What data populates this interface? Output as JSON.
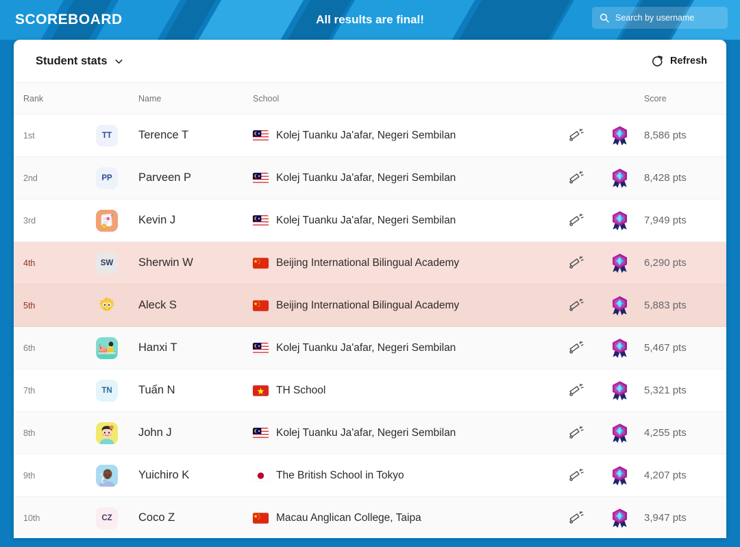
{
  "header": {
    "brand": "SCOREBOARD",
    "banner": "All results are final!",
    "search_placeholder": "Search by username",
    "search_value": "",
    "search_icon": "search-icon",
    "accent_blue": "#1b96d8",
    "header_blue": "#0c7cbe"
  },
  "toolbar": {
    "stats_label": "Student stats",
    "stats_caret_icon": "chevron-down-icon",
    "refresh_label": "Refresh",
    "refresh_icon": "refresh-icon"
  },
  "table": {
    "columns": [
      "Rank",
      "Name",
      "School",
      "Score"
    ],
    "megaphone_icon": "megaphone-icon",
    "badge_icon": "gem-award-badge-icon",
    "highlight_color": "#f9dfda",
    "rows": [
      {
        "rank": "1st",
        "name": "Terence T",
        "school": "Kolej Tuanku Ja'afar, Negeri Sembilan",
        "flag": "flag-malaysia",
        "score": "8,586 pts",
        "avatar_type": "initials",
        "avatar_text": "TT",
        "avatar_bg": "#eef2fb",
        "avatar_fg": "#2b4a8e",
        "highlight": false
      },
      {
        "rank": "2nd",
        "name": "Parveen P",
        "school": "Kolej Tuanku Ja'afar, Negeri Sembilan",
        "flag": "flag-malaysia",
        "score": "8,428 pts",
        "avatar_type": "initials",
        "avatar_text": "PP",
        "avatar_bg": "#eef2fb",
        "avatar_fg": "#2b4a8e",
        "highlight": false
      },
      {
        "rank": "3rd",
        "name": "Kevin J",
        "school": "Kolej Tuanku Ja'afar, Negeri Sembilan",
        "flag": "flag-malaysia",
        "score": "7,949 pts",
        "avatar_type": "picture-certificate",
        "avatar_text": "",
        "avatar_bg": "#f2a173",
        "avatar_fg": "#ffffff",
        "highlight": false
      },
      {
        "rank": "4th",
        "name": "Sherwin W",
        "school": "Beijing International Bilingual Academy",
        "flag": "flag-china",
        "score": "6,290 pts",
        "avatar_type": "initials",
        "avatar_text": "SW",
        "avatar_bg": "#e8e8e8",
        "avatar_fg": "#2b3a5e",
        "highlight": true
      },
      {
        "rank": "5th",
        "name": "Aleck S",
        "school": "Beijing International Bilingual Academy",
        "flag": "flag-china",
        "score": "5,883 pts",
        "avatar_type": "picture-monster",
        "avatar_text": "",
        "avatar_bg": "#f5d9d3",
        "avatar_fg": "#f6c336",
        "highlight": true
      },
      {
        "rank": "6th",
        "name": "Hanxi T",
        "school": "Kolej Tuanku Ja'afar, Negeri Sembilan",
        "flag": "flag-malaysia",
        "score": "5,467 pts",
        "avatar_type": "picture-dog",
        "avatar_text": "",
        "avatar_bg": "#7fdcd0",
        "avatar_fg": "#ffffff",
        "highlight": false
      },
      {
        "rank": "7th",
        "name": "Tuấn N",
        "school": "TH School",
        "flag": "flag-vietnam",
        "score": "5,321 pts",
        "avatar_type": "initials",
        "avatar_text": "TN",
        "avatar_bg": "#e3f4fb",
        "avatar_fg": "#2b6b8e",
        "highlight": false
      },
      {
        "rank": "8th",
        "name": "John J",
        "school": "Kolej Tuanku Ja'afar, Negeri Sembilan",
        "flag": "flag-malaysia",
        "score": "4,255 pts",
        "avatar_type": "picture-boy",
        "avatar_text": "",
        "avatar_bg": "#f2e96a",
        "avatar_fg": "#ffffff",
        "highlight": false
      },
      {
        "rank": "9th",
        "name": "Yuichiro K",
        "school": "The British School in Tokyo",
        "flag": "flag-japan",
        "score": "4,207 pts",
        "avatar_type": "picture-scientist",
        "avatar_text": "",
        "avatar_bg": "#a8dcf0",
        "avatar_fg": "#ffffff",
        "highlight": false
      },
      {
        "rank": "10th",
        "name": "Coco Z",
        "school": "Macau Anglican College, Taipa",
        "flag": "flag-china",
        "score": "3,947 pts",
        "avatar_type": "initials",
        "avatar_text": "CZ",
        "avatar_bg": "#fbeef1",
        "avatar_fg": "#4b3a60",
        "highlight": false
      }
    ]
  }
}
